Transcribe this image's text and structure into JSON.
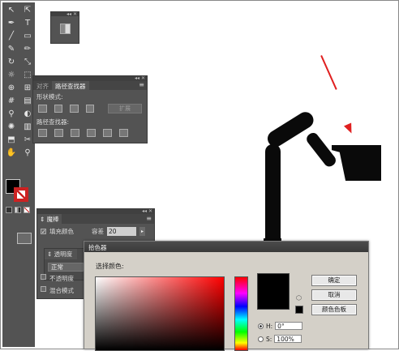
{
  "pathfinder": {
    "tab_align": "对齐",
    "tab_pathfinder": "路径查找器",
    "shape_modes_label": "形状模式:",
    "pathfinders_label": "路径查找器:",
    "expand_button": "扩展"
  },
  "magic_wand": {
    "title": "魔棒",
    "fill_color_label": "填充颜色",
    "tolerance_label": "容差",
    "tolerance_value": "20",
    "transparency_tab": "透明度",
    "blend_mode": "正常",
    "opacity_label": "不透明度",
    "blend_mode_label": "混合模式"
  },
  "color_picker": {
    "title": "拾色器",
    "select_color_label": "选择颜色:",
    "ok_button": "确定",
    "cancel_button": "取消",
    "swatches_button": "颜色色板",
    "h_label": "H:",
    "h_value": "0°",
    "s_label": "S:",
    "s_value": "100%",
    "selected_mode": "H"
  },
  "colors": {
    "panel_bg": "#535353",
    "canvas_shape": "#0a0a0a",
    "annotation_arrow": "#e02020",
    "current_color": "#000000"
  },
  "icons": [
    "selection-arrow",
    "direct-select",
    "pen",
    "type",
    "line",
    "rectangle",
    "paintbrush",
    "pencil",
    "rotate",
    "scale",
    "warp",
    "free-transform",
    "shape-builder",
    "perspective-grid",
    "mesh",
    "gradient",
    "eyedropper",
    "blend",
    "symbol-sprayer",
    "column-graph",
    "artboard",
    "slice",
    "hand",
    "zoom"
  ]
}
